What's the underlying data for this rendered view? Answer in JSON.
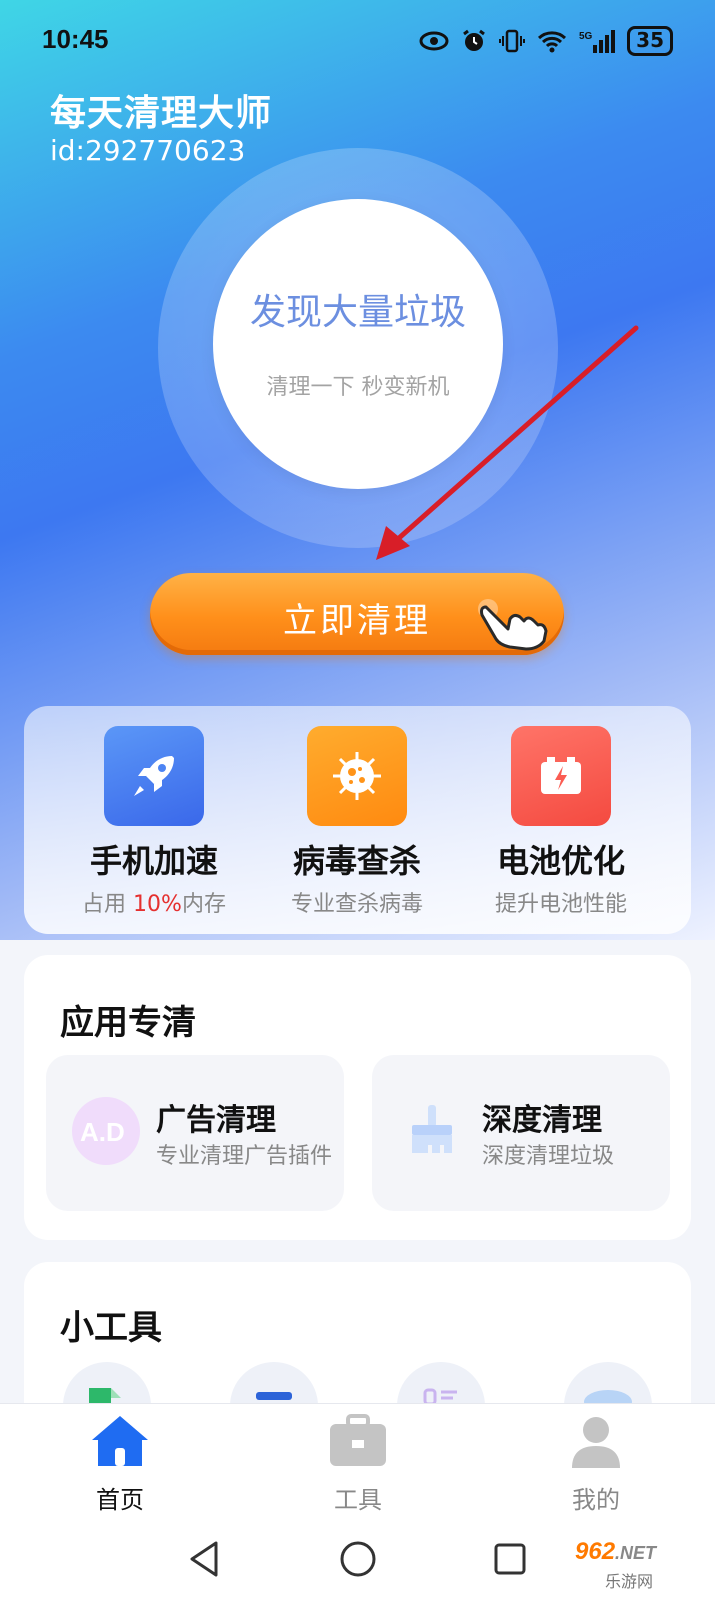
{
  "status_bar": {
    "time": "10:45",
    "battery": "35",
    "network": "5G"
  },
  "header": {
    "app_title": "每天清理大师",
    "user_id": "id:292770623"
  },
  "scan": {
    "title": "发现大量垃圾",
    "subtitle": "清理一下 秒变新机"
  },
  "clean_button": {
    "label": "立即清理"
  },
  "quick_actions": [
    {
      "title": "手机加速",
      "sub_prefix": "占用 ",
      "sub_highlight": "10%",
      "sub_suffix": "内存",
      "icon": "rocket-icon",
      "color": "#4d84f3"
    },
    {
      "title": "病毒查杀",
      "subtitle": "专业查杀病毒",
      "icon": "virus-icon",
      "color": "#ff9419"
    },
    {
      "title": "电池优化",
      "subtitle": "提升电池性能",
      "icon": "battery-icon",
      "color": "#fb5c52"
    }
  ],
  "app_clean": {
    "title": "应用专清",
    "items": [
      {
        "title": "广告清理",
        "subtitle": "专业清理广告插件",
        "icon": "ad-icon"
      },
      {
        "title": "深度清理",
        "subtitle": "深度清理垃圾",
        "icon": "brush-icon"
      }
    ]
  },
  "tools": {
    "title": "小工具"
  },
  "tabbar": {
    "items": [
      {
        "label": "首页",
        "icon": "home-icon",
        "active": true
      },
      {
        "label": "工具",
        "icon": "toolbox-icon",
        "active": false
      },
      {
        "label": "我的",
        "icon": "user-icon",
        "active": false
      }
    ]
  },
  "watermark": {
    "top": "962",
    "suffix": ".NET",
    "bottom": "乐游网"
  },
  "colors": {
    "accent": "#1f6cf2",
    "orange": "#ff8f1a",
    "highlight": "#e53030"
  }
}
